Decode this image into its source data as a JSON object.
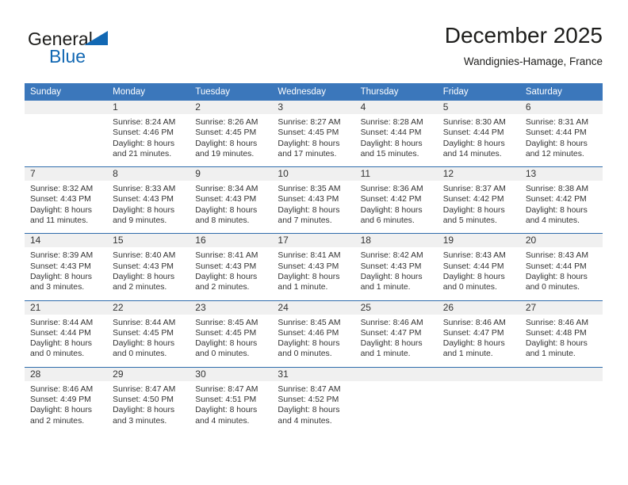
{
  "brand": {
    "name_top": "General",
    "name_bottom": "Blue",
    "triangle_icon": "triangle-icon",
    "accent_color": "#1268b3"
  },
  "header": {
    "title": "December 2025",
    "subtitle": "Wandignies-Hamage, France"
  },
  "theme": {
    "header_blue": "#3b77bb",
    "rule_blue": "#2f6cab",
    "daynum_band": "#f0f0f0"
  },
  "calendar": {
    "weekday_headers": [
      "Sunday",
      "Monday",
      "Tuesday",
      "Wednesday",
      "Thursday",
      "Friday",
      "Saturday"
    ],
    "weeks": [
      [
        {
          "day": "",
          "sunrise": "",
          "sunset": "",
          "daylight_1": "",
          "daylight_2": ""
        },
        {
          "day": "1",
          "sunrise": "Sunrise: 8:24 AM",
          "sunset": "Sunset: 4:46 PM",
          "daylight_1": "Daylight: 8 hours",
          "daylight_2": "and 21 minutes."
        },
        {
          "day": "2",
          "sunrise": "Sunrise: 8:26 AM",
          "sunset": "Sunset: 4:45 PM",
          "daylight_1": "Daylight: 8 hours",
          "daylight_2": "and 19 minutes."
        },
        {
          "day": "3",
          "sunrise": "Sunrise: 8:27 AM",
          "sunset": "Sunset: 4:45 PM",
          "daylight_1": "Daylight: 8 hours",
          "daylight_2": "and 17 minutes."
        },
        {
          "day": "4",
          "sunrise": "Sunrise: 8:28 AM",
          "sunset": "Sunset: 4:44 PM",
          "daylight_1": "Daylight: 8 hours",
          "daylight_2": "and 15 minutes."
        },
        {
          "day": "5",
          "sunrise": "Sunrise: 8:30 AM",
          "sunset": "Sunset: 4:44 PM",
          "daylight_1": "Daylight: 8 hours",
          "daylight_2": "and 14 minutes."
        },
        {
          "day": "6",
          "sunrise": "Sunrise: 8:31 AM",
          "sunset": "Sunset: 4:44 PM",
          "daylight_1": "Daylight: 8 hours",
          "daylight_2": "and 12 minutes."
        }
      ],
      [
        {
          "day": "7",
          "sunrise": "Sunrise: 8:32 AM",
          "sunset": "Sunset: 4:43 PM",
          "daylight_1": "Daylight: 8 hours",
          "daylight_2": "and 11 minutes."
        },
        {
          "day": "8",
          "sunrise": "Sunrise: 8:33 AM",
          "sunset": "Sunset: 4:43 PM",
          "daylight_1": "Daylight: 8 hours",
          "daylight_2": "and 9 minutes."
        },
        {
          "day": "9",
          "sunrise": "Sunrise: 8:34 AM",
          "sunset": "Sunset: 4:43 PM",
          "daylight_1": "Daylight: 8 hours",
          "daylight_2": "and 8 minutes."
        },
        {
          "day": "10",
          "sunrise": "Sunrise: 8:35 AM",
          "sunset": "Sunset: 4:43 PM",
          "daylight_1": "Daylight: 8 hours",
          "daylight_2": "and 7 minutes."
        },
        {
          "day": "11",
          "sunrise": "Sunrise: 8:36 AM",
          "sunset": "Sunset: 4:42 PM",
          "daylight_1": "Daylight: 8 hours",
          "daylight_2": "and 6 minutes."
        },
        {
          "day": "12",
          "sunrise": "Sunrise: 8:37 AM",
          "sunset": "Sunset: 4:42 PM",
          "daylight_1": "Daylight: 8 hours",
          "daylight_2": "and 5 minutes."
        },
        {
          "day": "13",
          "sunrise": "Sunrise: 8:38 AM",
          "sunset": "Sunset: 4:42 PM",
          "daylight_1": "Daylight: 8 hours",
          "daylight_2": "and 4 minutes."
        }
      ],
      [
        {
          "day": "14",
          "sunrise": "Sunrise: 8:39 AM",
          "sunset": "Sunset: 4:43 PM",
          "daylight_1": "Daylight: 8 hours",
          "daylight_2": "and 3 minutes."
        },
        {
          "day": "15",
          "sunrise": "Sunrise: 8:40 AM",
          "sunset": "Sunset: 4:43 PM",
          "daylight_1": "Daylight: 8 hours",
          "daylight_2": "and 2 minutes."
        },
        {
          "day": "16",
          "sunrise": "Sunrise: 8:41 AM",
          "sunset": "Sunset: 4:43 PM",
          "daylight_1": "Daylight: 8 hours",
          "daylight_2": "and 2 minutes."
        },
        {
          "day": "17",
          "sunrise": "Sunrise: 8:41 AM",
          "sunset": "Sunset: 4:43 PM",
          "daylight_1": "Daylight: 8 hours",
          "daylight_2": "and 1 minute."
        },
        {
          "day": "18",
          "sunrise": "Sunrise: 8:42 AM",
          "sunset": "Sunset: 4:43 PM",
          "daylight_1": "Daylight: 8 hours",
          "daylight_2": "and 1 minute."
        },
        {
          "day": "19",
          "sunrise": "Sunrise: 8:43 AM",
          "sunset": "Sunset: 4:44 PM",
          "daylight_1": "Daylight: 8 hours",
          "daylight_2": "and 0 minutes."
        },
        {
          "day": "20",
          "sunrise": "Sunrise: 8:43 AM",
          "sunset": "Sunset: 4:44 PM",
          "daylight_1": "Daylight: 8 hours",
          "daylight_2": "and 0 minutes."
        }
      ],
      [
        {
          "day": "21",
          "sunrise": "Sunrise: 8:44 AM",
          "sunset": "Sunset: 4:44 PM",
          "daylight_1": "Daylight: 8 hours",
          "daylight_2": "and 0 minutes."
        },
        {
          "day": "22",
          "sunrise": "Sunrise: 8:44 AM",
          "sunset": "Sunset: 4:45 PM",
          "daylight_1": "Daylight: 8 hours",
          "daylight_2": "and 0 minutes."
        },
        {
          "day": "23",
          "sunrise": "Sunrise: 8:45 AM",
          "sunset": "Sunset: 4:45 PM",
          "daylight_1": "Daylight: 8 hours",
          "daylight_2": "and 0 minutes."
        },
        {
          "day": "24",
          "sunrise": "Sunrise: 8:45 AM",
          "sunset": "Sunset: 4:46 PM",
          "daylight_1": "Daylight: 8 hours",
          "daylight_2": "and 0 minutes."
        },
        {
          "day": "25",
          "sunrise": "Sunrise: 8:46 AM",
          "sunset": "Sunset: 4:47 PM",
          "daylight_1": "Daylight: 8 hours",
          "daylight_2": "and 1 minute."
        },
        {
          "day": "26",
          "sunrise": "Sunrise: 8:46 AM",
          "sunset": "Sunset: 4:47 PM",
          "daylight_1": "Daylight: 8 hours",
          "daylight_2": "and 1 minute."
        },
        {
          "day": "27",
          "sunrise": "Sunrise: 8:46 AM",
          "sunset": "Sunset: 4:48 PM",
          "daylight_1": "Daylight: 8 hours",
          "daylight_2": "and 1 minute."
        }
      ],
      [
        {
          "day": "28",
          "sunrise": "Sunrise: 8:46 AM",
          "sunset": "Sunset: 4:49 PM",
          "daylight_1": "Daylight: 8 hours",
          "daylight_2": "and 2 minutes."
        },
        {
          "day": "29",
          "sunrise": "Sunrise: 8:47 AM",
          "sunset": "Sunset: 4:50 PM",
          "daylight_1": "Daylight: 8 hours",
          "daylight_2": "and 3 minutes."
        },
        {
          "day": "30",
          "sunrise": "Sunrise: 8:47 AM",
          "sunset": "Sunset: 4:51 PM",
          "daylight_1": "Daylight: 8 hours",
          "daylight_2": "and 4 minutes."
        },
        {
          "day": "31",
          "sunrise": "Sunrise: 8:47 AM",
          "sunset": "Sunset: 4:52 PM",
          "daylight_1": "Daylight: 8 hours",
          "daylight_2": "and 4 minutes."
        },
        {
          "day": "",
          "sunrise": "",
          "sunset": "",
          "daylight_1": "",
          "daylight_2": ""
        },
        {
          "day": "",
          "sunrise": "",
          "sunset": "",
          "daylight_1": "",
          "daylight_2": ""
        },
        {
          "day": "",
          "sunrise": "",
          "sunset": "",
          "daylight_1": "",
          "daylight_2": ""
        }
      ]
    ]
  }
}
